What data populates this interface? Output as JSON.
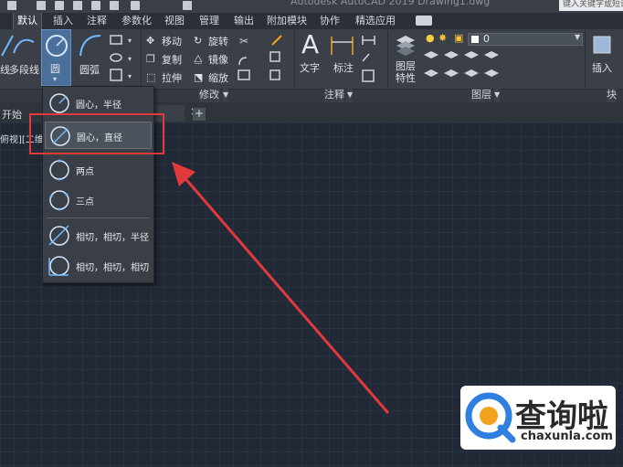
{
  "title_bar": {
    "title": "Autodesk AutoCAD 2019    Drawing1.dwg",
    "search_placeholder": "键入关键字或短语"
  },
  "ribbon_tabs": [
    "默认",
    "插入",
    "注释",
    "参数化",
    "视图",
    "管理",
    "输出",
    "附加模块",
    "协作",
    "精选应用"
  ],
  "active_tab": "默认",
  "draw_panel": {
    "line_label": "线",
    "polyline_label": "多段线",
    "circle_label": "圆",
    "arc_label": "圆弧"
  },
  "modify_panel": {
    "title": "修改",
    "move": "移动",
    "rotate": "旋转",
    "copy": "复制",
    "mirror": "镜像",
    "stretch": "拉伸",
    "scale": "缩放"
  },
  "annotation_panel": {
    "title": "注释",
    "text": "文字",
    "dimension": "标注"
  },
  "layers_panel": {
    "title": "图层",
    "layer_properties": "图层\n特性",
    "current_layer": "0"
  },
  "block_panel": {
    "title": "块",
    "insert": "插入"
  },
  "doc_tabs": {
    "start": "开始",
    "viewport_label": "俯视][二维"
  },
  "circle_menu": {
    "items": [
      {
        "label": "圆心，半径"
      },
      {
        "label": "圆心，直径"
      },
      {
        "label": "两点"
      },
      {
        "label": "三点"
      },
      {
        "label": "相切，相切，半径"
      },
      {
        "label": "相切，相切，相切"
      }
    ],
    "highlighted_index": 1
  },
  "colors": {
    "canvas": "#212836",
    "ribbon": "#3b4048",
    "annotation_red": "#e03a3a",
    "logo_blue": "#2f7fe0",
    "logo_orange": "#f2a21b"
  },
  "watermark": {
    "brand": "查询啦",
    "domain": "chaxunla.com"
  }
}
